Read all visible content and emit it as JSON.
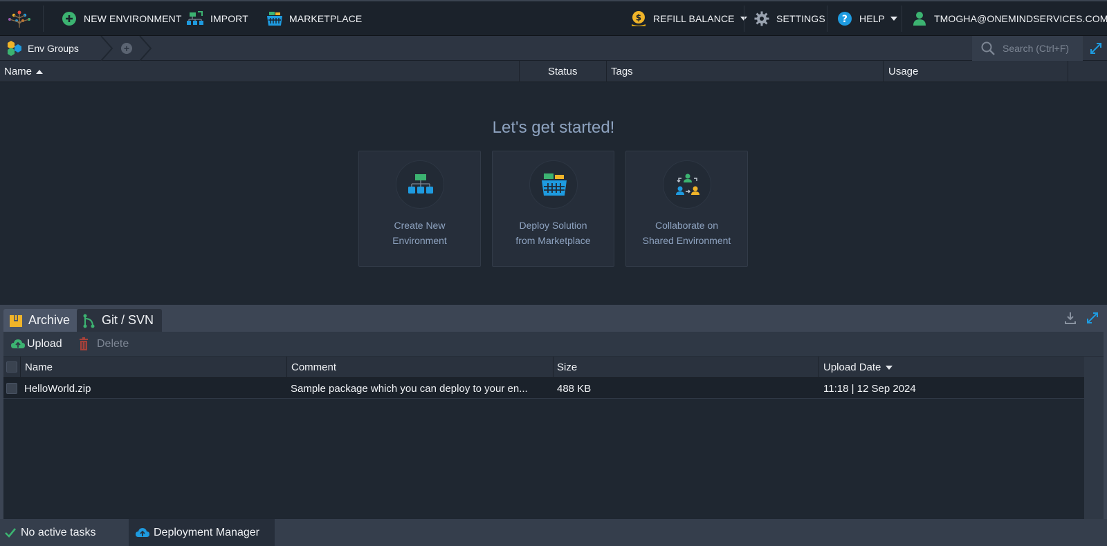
{
  "topbar": {
    "new_environment": "NEW ENVIRONMENT",
    "import": "IMPORT",
    "marketplace": "MARKETPLACE",
    "refill_balance": "REFILL BALANCE",
    "settings": "SETTINGS",
    "help": "HELP",
    "user_email": "TMOGHA@ONEMINDSERVICES.COM"
  },
  "groupbar": {
    "env_groups": "Env Groups",
    "search_placeholder": "Search (Ctrl+F)"
  },
  "env_table": {
    "columns": [
      "Name",
      "Status",
      "Tags",
      "Usage"
    ]
  },
  "getting_started": {
    "title": "Let's get started!",
    "cards": [
      {
        "line1": "Create New",
        "line2": "Environment"
      },
      {
        "line1": "Deploy Solution",
        "line2": "from Marketplace"
      },
      {
        "line1": "Collaborate on",
        "line2": "Shared Environment"
      }
    ]
  },
  "deployment": {
    "tabs": [
      "Archive",
      "Git / SVN"
    ],
    "toolbar": {
      "upload": "Upload",
      "delete": "Delete"
    },
    "columns": [
      "Name",
      "Comment",
      "Size",
      "Upload Date"
    ],
    "rows": [
      {
        "name": "HelloWorld.zip",
        "comment": "Sample package which you can deploy to your en...",
        "size": "488 KB",
        "date": "11:18 | 12 Sep 2024"
      }
    ]
  },
  "statusbar": {
    "tasks": "No active tasks",
    "deployment_manager": "Deployment Manager"
  },
  "colors": {
    "background": "#1f2731",
    "topbar": "#1b222b",
    "accent_text": "#8ea3c0",
    "green": "#3cb371",
    "blue": "#1e9be0",
    "yellow": "#f0b429",
    "red": "#c0392b"
  }
}
